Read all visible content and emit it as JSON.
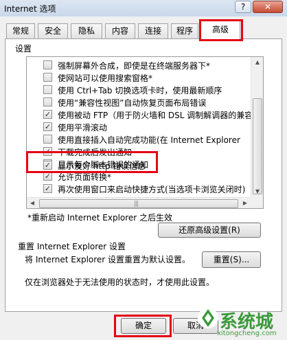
{
  "window": {
    "title": "Internet 选项",
    "help_label": "?",
    "close_label": "✕"
  },
  "tabs": [
    {
      "label": "常规",
      "active": false
    },
    {
      "label": "安全",
      "active": false
    },
    {
      "label": "隐私",
      "active": false
    },
    {
      "label": "内容",
      "active": false
    },
    {
      "label": "连接",
      "active": false
    },
    {
      "label": "程序",
      "active": false
    },
    {
      "label": "高级",
      "active": true
    }
  ],
  "settings": {
    "group_label": "设置",
    "items": [
      {
        "label": "强制屏幕外合成，即使是在终端服务器下*",
        "checked": false
      },
      {
        "label": "使网站可以使用搜索窗格*",
        "checked": false
      },
      {
        "label": "使用 Ctrl+Tab 切换选项卡时，使用最新顺序",
        "checked": false
      },
      {
        "label": "使用“兼容性视图”自动恢复页面布局错误",
        "checked": false
      },
      {
        "label": "使用被动 FTP（用于防火墙和 DSL 调制解调器的兼容",
        "checked": true
      },
      {
        "label": "使用平滑滚动",
        "checked": true
      },
      {
        "label": "使用直接插入自动完成功能(在 Internet Explorer",
        "checked": false
      },
      {
        "label": "下载完成后发出通知",
        "checked": true
      },
      {
        "label": "显示每个脚本错误的通知",
        "checked": false
      },
      {
        "label": "显示友好 http 错误信息",
        "checked": true
      },
      {
        "label": "允许页面转换*",
        "checked": true
      },
      {
        "label": "再次使用窗口来启动快捷方式(当选项卡浏览关闭时)",
        "checked": true
      }
    ],
    "scroll_grip": "|||",
    "restart_note": "*重新启动 Internet Explorer 之后生效",
    "restore_button": "还原高级设置(R)"
  },
  "reset": {
    "title": "重置 Internet Explorer 设置",
    "description": "将 Internet Explorer 设置重置为默认设置。",
    "button": "重置(S)...",
    "note": "仅在浏览器处于无法使用的状态时，才使用此设置。"
  },
  "footer": {
    "ok_button": "确定",
    "cancel_button": "取消"
  },
  "watermark": {
    "title": "系统城",
    "url": "xitongcheng.com"
  },
  "colors": {
    "highlight": "#e60012",
    "watermark": "#3a9a3a"
  }
}
